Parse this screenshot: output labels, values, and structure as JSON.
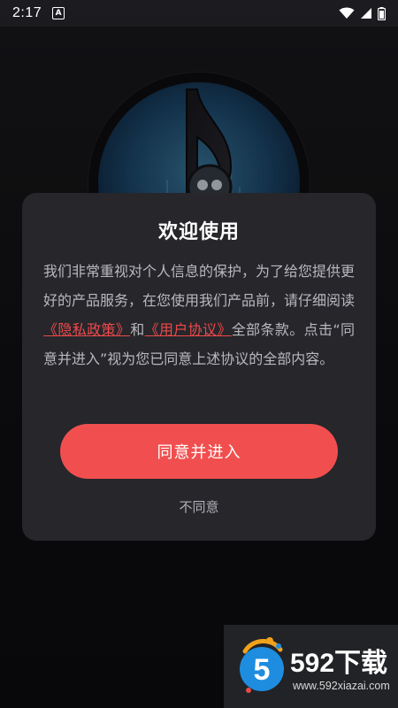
{
  "status_bar": {
    "time": "2:17",
    "notification_badge": "A",
    "icons": [
      "wifi-icon",
      "signal-icon",
      "battery-icon"
    ]
  },
  "dialog": {
    "title": "欢迎使用",
    "body_text_1": "我们非常重视对个人信息的保护，为了给您提供更好的产品服务，在您使用我们产品前，请仔细阅读",
    "privacy_link": "《隐私政策》",
    "conjunction": "和",
    "terms_link": "《用户协议》",
    "body_text_2": "全部条款。点击“同意并进入”视为您已同意上述协议的全部内容。",
    "agree_label": "同意并进入",
    "disagree_label": "不同意"
  },
  "watermark": {
    "title": "592下载",
    "url": "www.592xiazai.com",
    "logo_digit": "5"
  },
  "colors": {
    "accent": "#f14f4f",
    "link": "#ee4a4a",
    "dialog_bg": "#26262b",
    "page_bg": "#151518"
  }
}
